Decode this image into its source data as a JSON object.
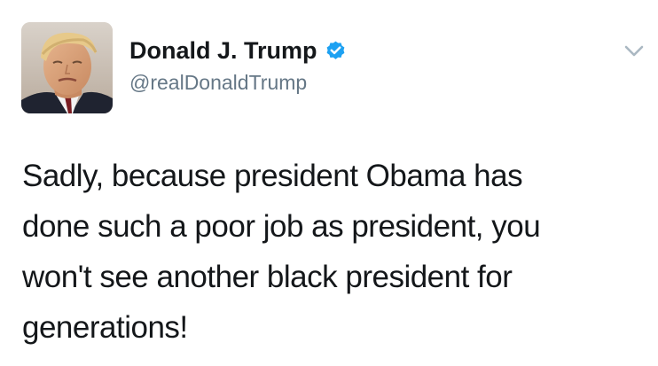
{
  "author": {
    "display_name": "Donald J. Trump",
    "handle": "@realDonaldTrump",
    "verified": true,
    "verified_icon": "verified-badge-icon",
    "verified_color": "#1da1f2"
  },
  "menu": {
    "icon": "chevron-down-icon",
    "color": "#aab8c2"
  },
  "tweet": {
    "text": "Sadly, because president Obama has\ndone such a poor job as president, you\nwon't see another black president for\ngenerations!"
  }
}
